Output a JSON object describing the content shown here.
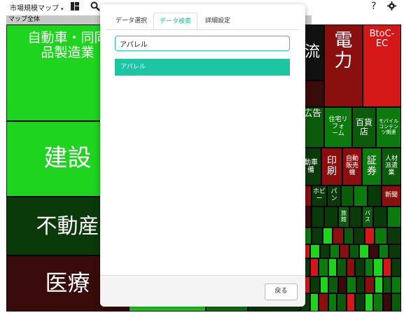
{
  "header": {
    "app_title": "市場規模マップ",
    "caret": "▾",
    "help": "?",
    "icons": [
      "dashboard-icon",
      "search-zoom-icon",
      "help-icon",
      "gear-icon"
    ]
  },
  "map": {
    "section_label": "マップ全体",
    "cells": {
      "c1": "自動車・同同\n品製造業",
      "c2": "建設",
      "c3": "不動産",
      "c4": "医療",
      "c5": "流",
      "c6": "電\n力",
      "c7": "BtoC-\nEC",
      "c8": "広告",
      "c9": "住宅リ\nフォ\nーム",
      "c10": "百貨\n店",
      "c11": "モバイル\nコンテン\nツ関連",
      "c12": "動車\n備",
      "c13": "印\n刷",
      "c14": "自動\n販売\n機",
      "c15": "証\n券",
      "c16": "人材\n派遣\n業",
      "c17": "ホビ\nー",
      "c18": "パ\nン",
      "c19": "新聞",
      "c20": "旅\n館",
      "c21": "バ\nス"
    }
  },
  "modal": {
    "tabs": [
      "データ選択",
      "データ検索",
      "詳細設定"
    ],
    "active_tab": "データ検索",
    "search_value": "アパレル",
    "results": [
      "アパレル"
    ],
    "back_label": "戻る"
  }
}
